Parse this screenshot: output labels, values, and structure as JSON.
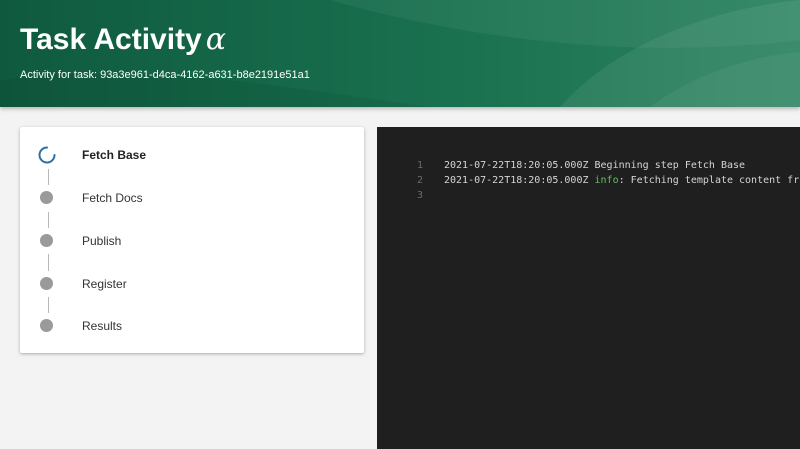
{
  "header": {
    "title": "Task Activity",
    "title_symbol": "α",
    "subtitle": "Activity for task: 93a3e961-d4ca-4162-a631-b8e2191e51a1"
  },
  "steps": [
    {
      "label": "Fetch Base",
      "status": "running",
      "icon": "spinner-icon"
    },
    {
      "label": "Fetch Docs",
      "status": "pending",
      "icon": "pending-dot-icon"
    },
    {
      "label": "Publish",
      "status": "pending",
      "icon": "pending-dot-icon"
    },
    {
      "label": "Register",
      "status": "pending",
      "icon": "pending-dot-icon"
    },
    {
      "label": "Results",
      "status": "pending",
      "icon": "pending-dot-icon"
    }
  ],
  "log": {
    "lines": [
      {
        "number": "1",
        "prefix": "2021-07-22T18:20:05.000Z Beginning step Fetch Base",
        "level": "",
        "message": ""
      },
      {
        "number": "2",
        "prefix": "2021-07-22T18:20:05.000Z ",
        "level": "info",
        "message": ": Fetching template content from r"
      },
      {
        "number": "3",
        "prefix": "",
        "level": "",
        "message": ""
      }
    ]
  },
  "colors": {
    "header_green": "#19704f",
    "spinner_blue": "#2e6ea6",
    "pending_gray": "#9a9a9a",
    "log_background": "#1f1f1f",
    "info_green": "#5dc05d"
  }
}
